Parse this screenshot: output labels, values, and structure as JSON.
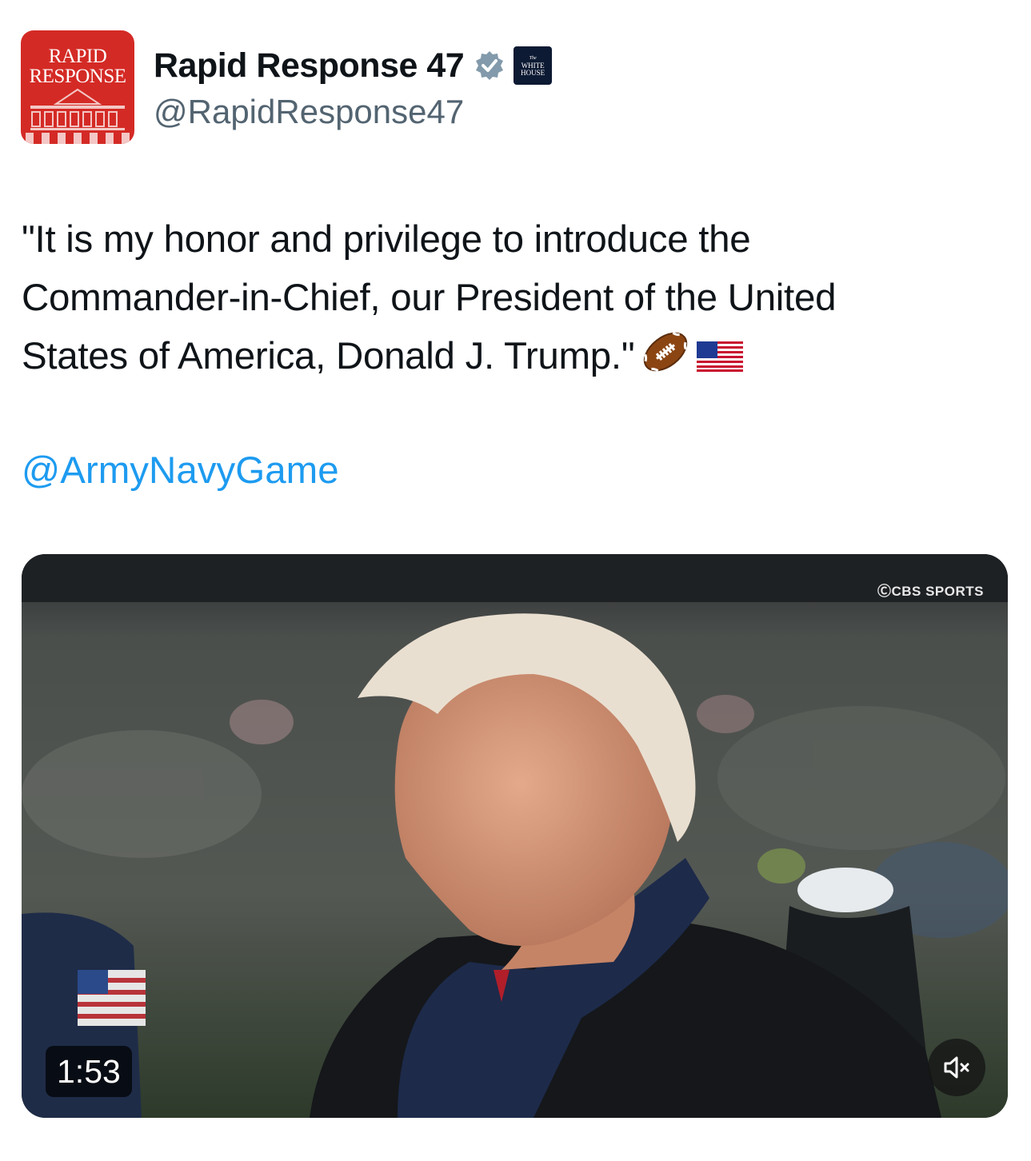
{
  "author": {
    "avatar_text": [
      "RAPID",
      "RESPONSE"
    ],
    "display_name": "Rapid Response 47",
    "handle": "@RapidResponse47",
    "verified_icon": "verified-badge-icon",
    "affiliation": {
      "small": "The",
      "lines": [
        "WHITE",
        "HOUSE"
      ]
    }
  },
  "tweet": {
    "text": "\"It is my honor and privilege to introduce the\nCommander-in-Chief, our President of the United\nStates of America, Donald J. Trump.\"",
    "emojis": [
      "football-icon",
      "us-flag-icon"
    ],
    "mention": "@ArmyNavyGame"
  },
  "media": {
    "watermark": "ⒸCBS SPORTS",
    "duration": "1:53",
    "mute_icon": "volume-muted-icon"
  },
  "colors": {
    "link": "#1d9bf0",
    "secondary_text": "#536471",
    "avatar_red": "#d42a25",
    "verified": "#829aab"
  }
}
